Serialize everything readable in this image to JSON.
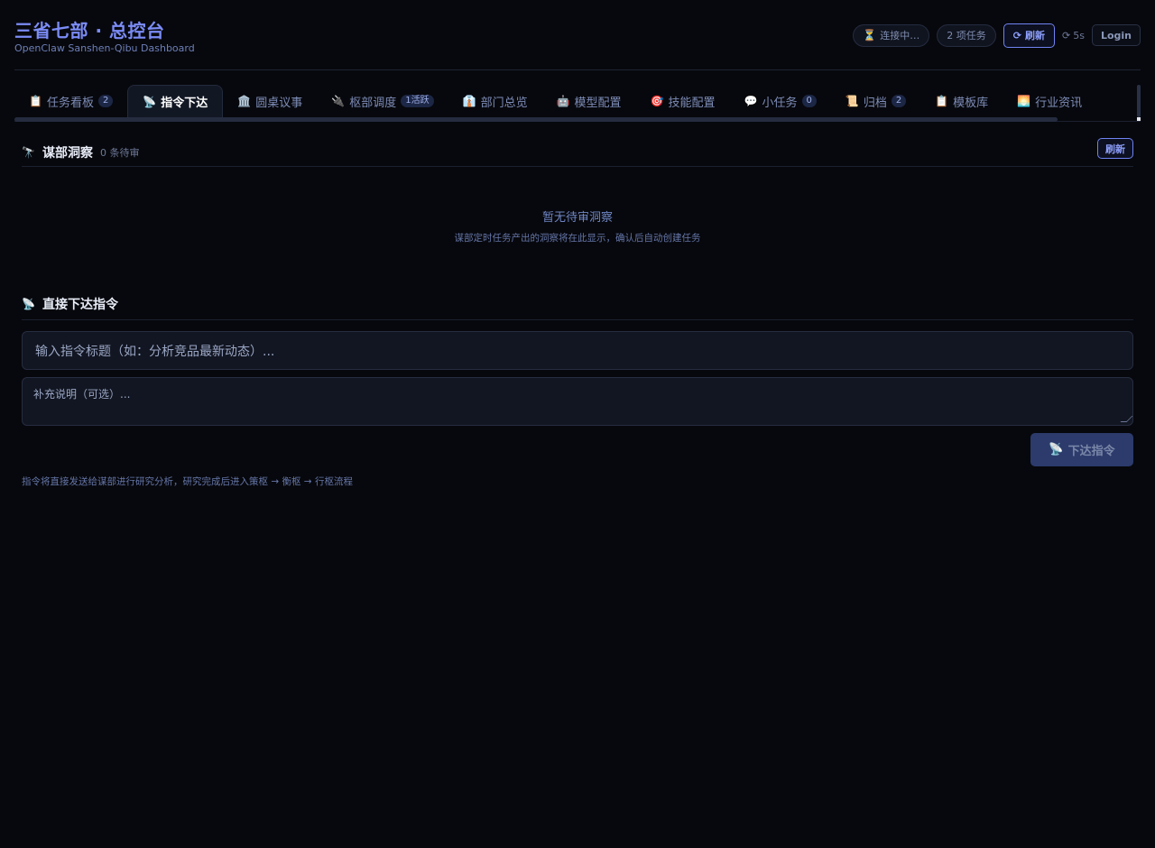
{
  "header": {
    "title": "三省七部 · 总控台",
    "subtitle": "OpenClaw Sanshen-Qibu Dashboard",
    "status_icon": "⏳",
    "status_text": "连接中…",
    "task_count": "2 项任务",
    "refresh_icon": "⟳",
    "refresh_label": "刷新",
    "countdown_icon": "⟳",
    "countdown": "5s",
    "login_label": "Login"
  },
  "tabs": [
    {
      "icon": "📋",
      "label": "任务看板",
      "badge": "2"
    },
    {
      "icon": "📡",
      "label": "指令下达",
      "badge": ""
    },
    {
      "icon": "🏛️",
      "label": "圆桌议事",
      "badge": ""
    },
    {
      "icon": "🔌",
      "label": "枢部调度",
      "badge": "1活跃"
    },
    {
      "icon": "👔",
      "label": "部门总览",
      "badge": ""
    },
    {
      "icon": "🤖",
      "label": "模型配置",
      "badge": ""
    },
    {
      "icon": "🎯",
      "label": "技能配置",
      "badge": ""
    },
    {
      "icon": "💬",
      "label": "小任务",
      "badge": "0"
    },
    {
      "icon": "📜",
      "label": "归档",
      "badge": "2"
    },
    {
      "icon": "📋",
      "label": "模板库",
      "badge": ""
    },
    {
      "icon": "🌅",
      "label": "行业资讯",
      "badge": ""
    }
  ],
  "active_tab": "指令下达",
  "insight": {
    "icon": "🔭",
    "title": "谋部洞察",
    "count": "0 条待审",
    "refresh_label": "刷新",
    "empty_title": "暂无待审洞察",
    "empty_sub": "谋部定时任务产出的洞察将在此显示，确认后自动创建任务"
  },
  "command": {
    "icon": "📡",
    "title": "直接下达指令",
    "title_placeholder": "输入指令标题（如：分析竞品最新动态）...",
    "desc_placeholder": "补充说明（可选）...",
    "submit_icon": "📡",
    "submit_label": "下达指令",
    "hint": "指令将直接发送给谋部进行研究分析，研究完成后进入策枢 → 衡枢 → 行枢流程"
  },
  "colors": {
    "background": "#07080d",
    "accent": "#7b8cf6",
    "muted": "#6d7898",
    "submit_disabled": "#2c3b6c"
  }
}
